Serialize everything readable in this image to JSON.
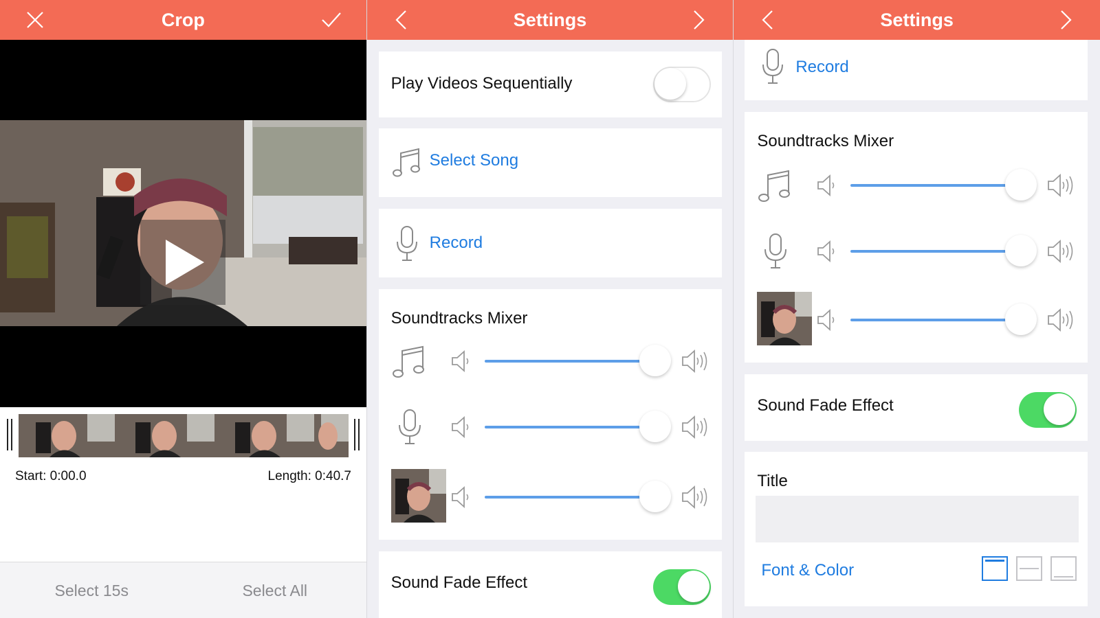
{
  "colors": {
    "accent": "#f36b55",
    "link": "#1f7ce0",
    "toggle_on": "#4cd964",
    "slider": "#5d9ee8"
  },
  "crop": {
    "title": "Crop",
    "left_icon": "close-icon",
    "right_icon": "checkmark-icon",
    "start_label": "Start: 0:00.0",
    "length_label": "Length: 0:40.7",
    "select_15s": "Select 15s",
    "select_all": "Select All"
  },
  "settings1": {
    "title": "Settings",
    "play_sequential_label": "Play Videos Sequentially",
    "play_sequential_on": false,
    "select_song": "Select Song",
    "record": "Record",
    "mixer_title": "Soundtracks Mixer",
    "mixer": [
      {
        "source": "music-note-icon",
        "level": 1.0
      },
      {
        "source": "microphone-icon",
        "level": 1.0
      },
      {
        "source": "video-thumbnail",
        "level": 1.0
      }
    ],
    "fade_label": "Sound Fade Effect",
    "fade_on": true
  },
  "settings2": {
    "title": "Settings",
    "record": "Record",
    "mixer_title": "Soundtracks Mixer",
    "mixer": [
      {
        "source": "music-note-icon",
        "level": 1.0
      },
      {
        "source": "microphone-icon",
        "level": 1.0
      },
      {
        "source": "video-thumbnail",
        "level": 1.0
      }
    ],
    "fade_label": "Sound Fade Effect",
    "fade_on": true,
    "title_section_label": "Title",
    "title_value": "",
    "font_color_link": "Font & Color"
  }
}
